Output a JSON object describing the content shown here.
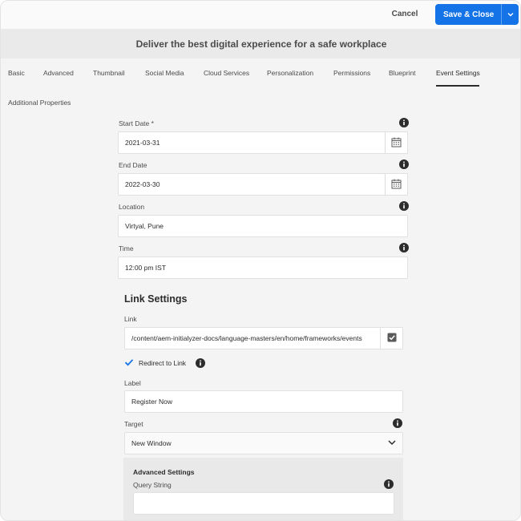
{
  "topbar": {
    "cancel_label": "Cancel",
    "save_label": "Save & Close"
  },
  "page_title": "Deliver the best digital experience for a safe workplace",
  "tabs": [
    {
      "label": "Basic",
      "active": false
    },
    {
      "label": "Advanced",
      "active": false
    },
    {
      "label": "Thumbnail",
      "active": false
    },
    {
      "label": "Social Media",
      "active": false
    },
    {
      "label": "Cloud Services",
      "active": false
    },
    {
      "label": "Personalization",
      "active": false
    },
    {
      "label": "Permissions",
      "active": false
    },
    {
      "label": "Blueprint",
      "active": false
    },
    {
      "label": "Event Settings",
      "active": true
    },
    {
      "label": "Additional Properties",
      "active": false
    }
  ],
  "event_fields": {
    "start_date": {
      "label": "Start Date *",
      "value": "2021-03-31"
    },
    "end_date": {
      "label": "End Date",
      "value": "2022-03-30"
    },
    "location": {
      "label": "Location",
      "value": "Virtyal, Pune"
    },
    "time": {
      "label": "Time",
      "value": "12:00 pm IST"
    }
  },
  "link_settings": {
    "heading": "Link Settings",
    "link": {
      "label": "Link",
      "value": "/content/aem-initialyzer-docs/language-masters/en/home/frameworks/events"
    },
    "redirect": {
      "label": "Redirect to Link",
      "checked": true
    },
    "label_field": {
      "label": "Label",
      "value": "Register Now"
    },
    "target": {
      "label": "Target",
      "selected": "New Window"
    }
  },
  "advanced_settings": {
    "heading": "Advanced Settings",
    "query_string": {
      "label": "Query String",
      "value": ""
    }
  },
  "colors": {
    "accent": "#1473e6",
    "background": "#f4f4f4",
    "title_bar": "#eaeaea",
    "checkbox_blue": "#1473e6"
  },
  "icons": {
    "info": "info-icon",
    "calendar": "calendar-icon",
    "checkmark": "checkmark-icon",
    "chevron": "chevron-down-icon"
  }
}
